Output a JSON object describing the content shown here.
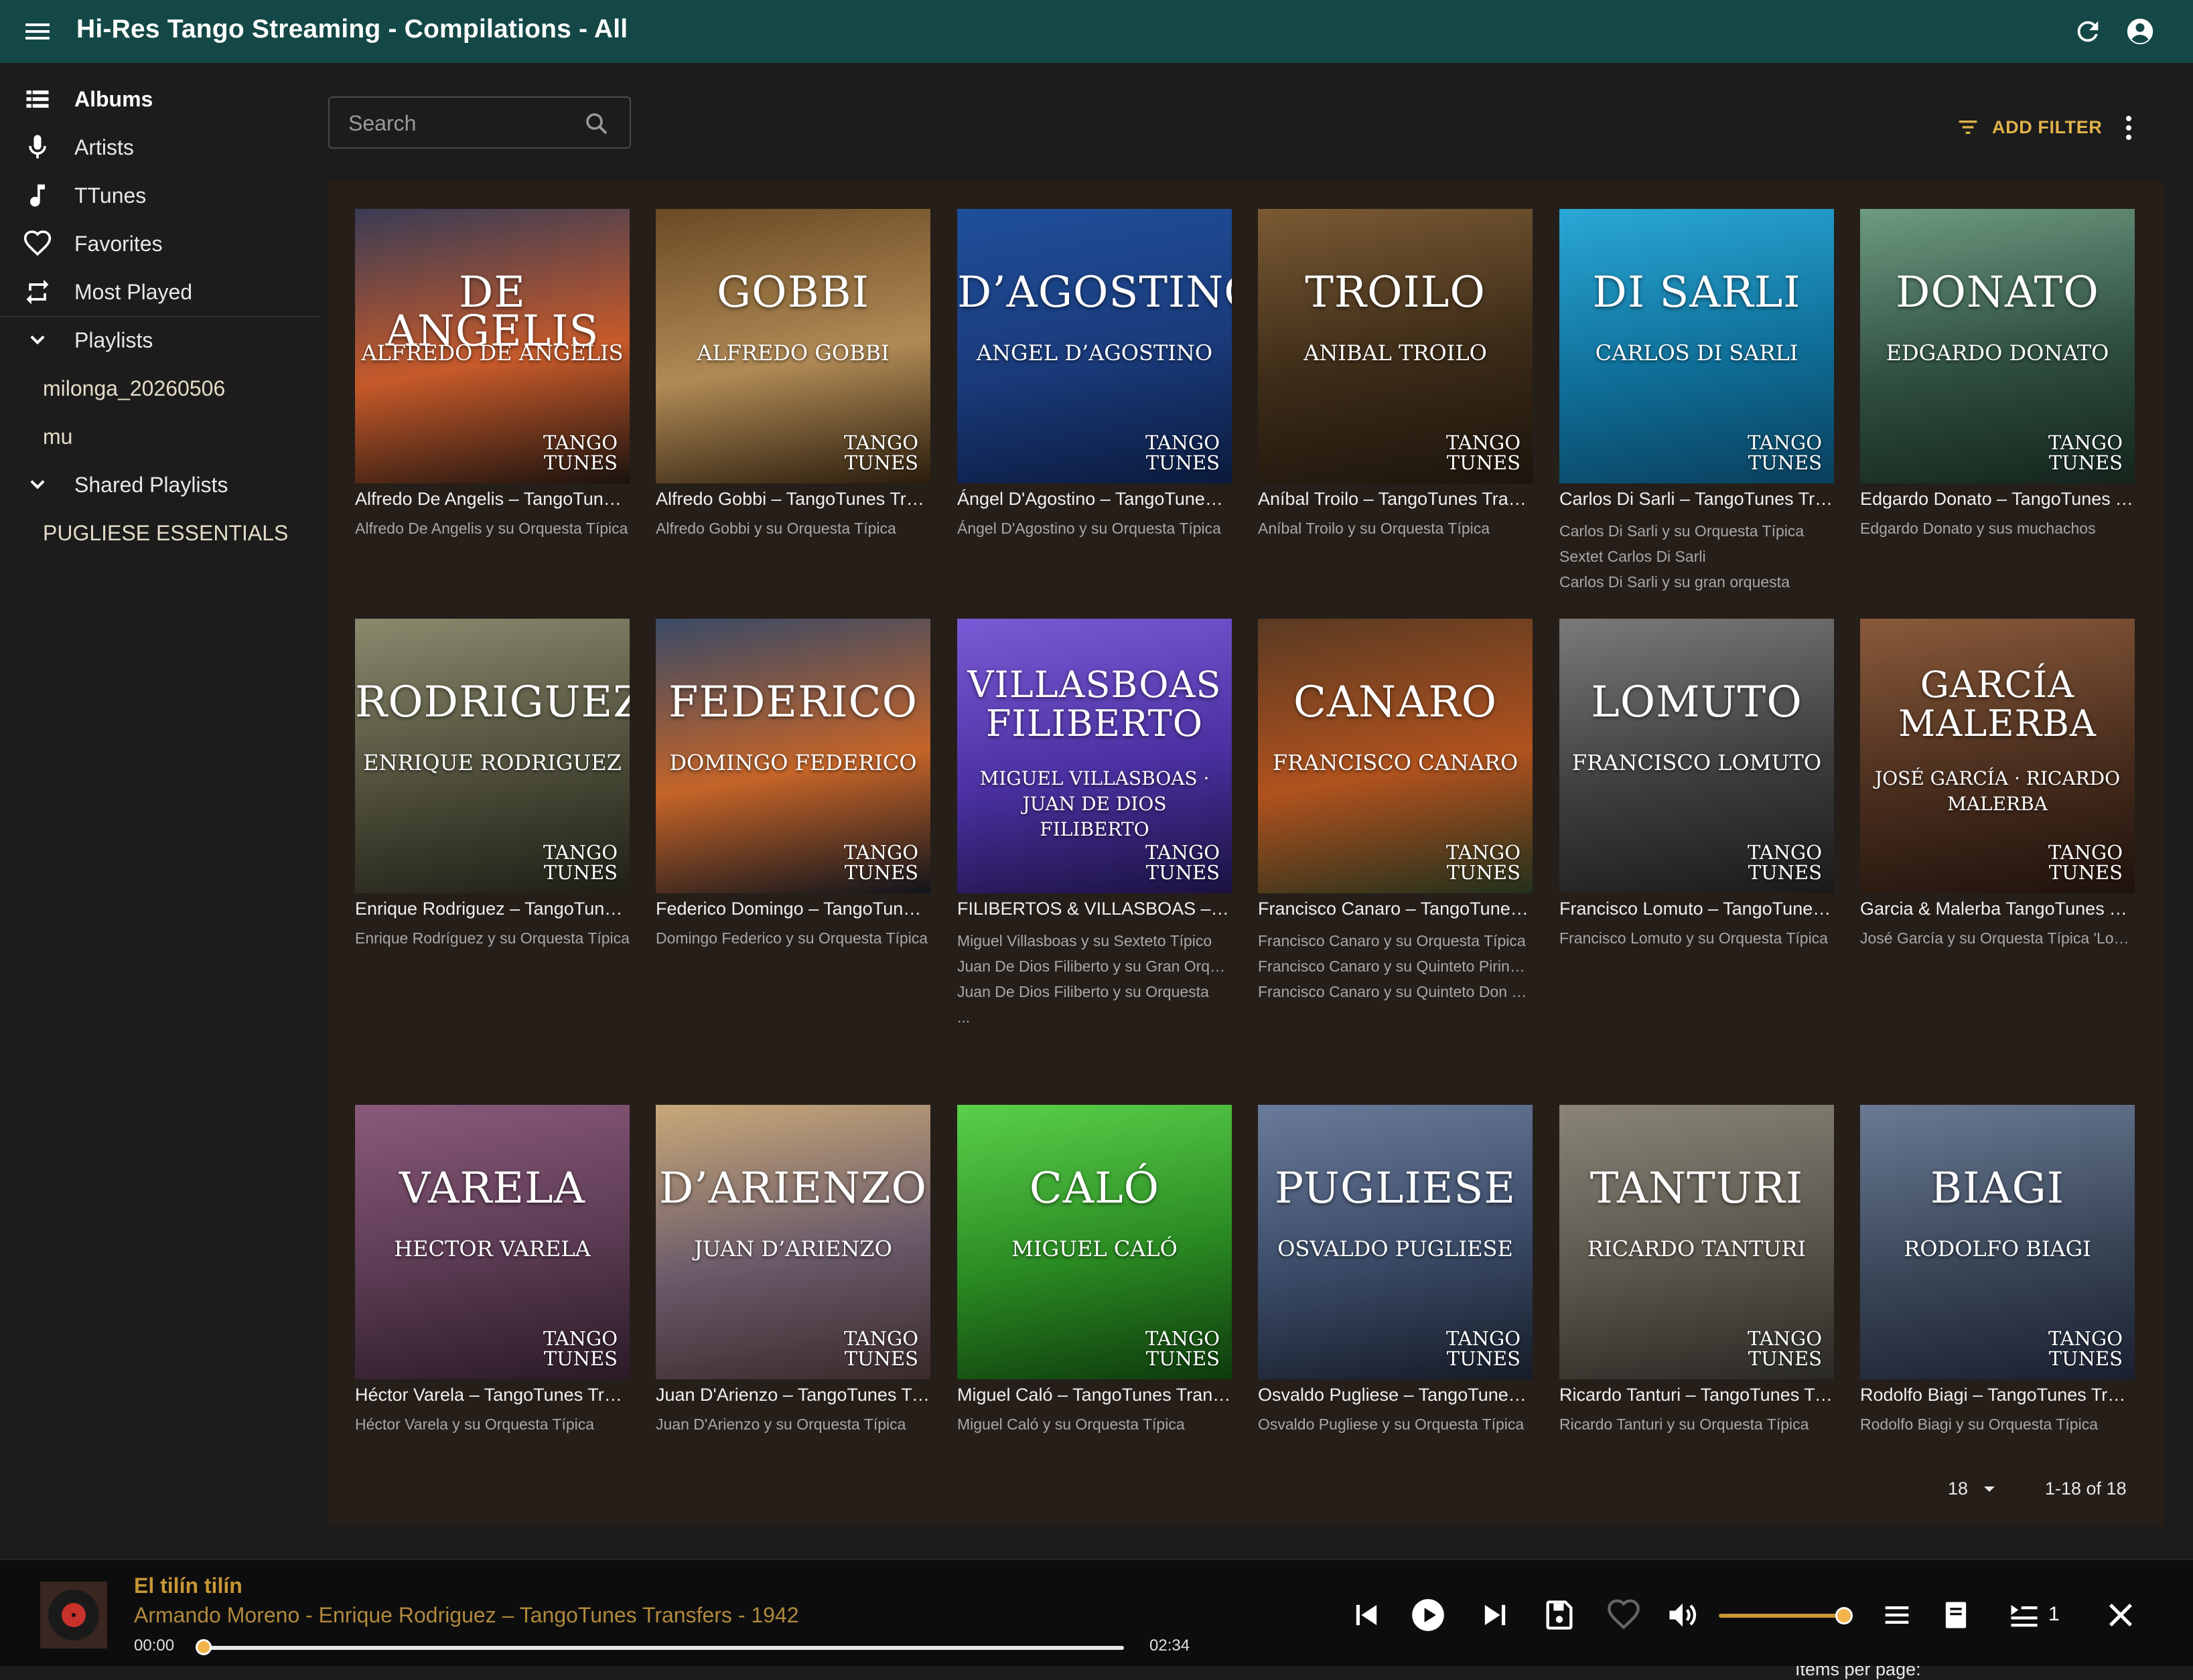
{
  "app": {
    "title": "Hi-Res Tango Streaming - Compilations - All"
  },
  "sidebar": {
    "items": [
      {
        "label": "Albums",
        "icon": "albums-icon"
      },
      {
        "label": "Artists",
        "icon": "microphone-icon"
      },
      {
        "label": "TTunes",
        "icon": "music-note-icon"
      },
      {
        "label": "Favorites",
        "icon": "heart-icon"
      },
      {
        "label": "Most Played",
        "icon": "repeat-icon"
      }
    ],
    "playlists_label": "Playlists",
    "playlists": [
      "milonga_20260506",
      "mu"
    ],
    "shared_label": "Shared Playlists",
    "shared": [
      "PUGLIESE ESSENTIALS"
    ]
  },
  "search": {
    "placeholder": "Search"
  },
  "toolbar": {
    "add_filter": "ADD FILTER"
  },
  "albums": [
    {
      "cover_title": "DE ANGELIS",
      "cover_sub": "ALFREDO DE ANGELIS",
      "title": "Alfredo De Angelis – TangoTunes Transfers",
      "artists": [
        "Alfredo De Angelis y su Orquesta Típica"
      ],
      "colors": [
        "#3a3c55",
        "#c65a2a",
        "#1a120e"
      ]
    },
    {
      "cover_title": "GOBBI",
      "cover_sub": "ALFREDO GOBBI",
      "title": "Alfredo Gobbi – TangoTunes Transfers",
      "artists": [
        "Alfredo Gobbi y su Orquesta Típica"
      ],
      "colors": [
        "#6b4a24",
        "#b08a55",
        "#2a1c0c"
      ]
    },
    {
      "cover_title": "D’AGOSTINO",
      "cover_sub": "ANGEL D’AGOSTINO",
      "title": "Ángel D'Agostino – TangoTunes Transfers",
      "artists": [
        "Ángel D'Agostino y su Orquesta Típica"
      ],
      "colors": [
        "#1f4f9a",
        "#1a3a7a",
        "#0b1a3c"
      ]
    },
    {
      "cover_title": "TROILO",
      "cover_sub": "ANIBAL TROILO",
      "title": "Aníbal Troilo – TangoTunes Transfers",
      "artists": [
        "Aníbal Troilo y su Orquesta Típica"
      ],
      "colors": [
        "#7a5a33",
        "#3c2b18",
        "#1c140c"
      ]
    },
    {
      "cover_title": "DI SARLI",
      "cover_sub": "CARLOS DI SARLI",
      "title": "Carlos Di Sarli – TangoTunes Transfers",
      "artists": [
        "Carlos Di Sarli y su Orquesta Típica",
        "Sextet Carlos Di Sarli",
        "Carlos Di Sarli y su gran orquesta"
      ],
      "colors": [
        "#2aa8d6",
        "#0f6f99",
        "#0a3f5c"
      ]
    },
    {
      "cover_title": "DONATO",
      "cover_sub": "EDGARDO DONATO",
      "title": "Edgardo Donato – TangoTunes Transfers",
      "artists": [
        "Edgardo Donato y sus muchachos"
      ],
      "colors": [
        "#6e9a82",
        "#2f4f40",
        "#14241c"
      ]
    },
    {
      "cover_title": "RODRIGUEZ",
      "cover_sub": "ENRIQUE RODRIGUEZ",
      "title": "Enrique Rodriguez – TangoTunes Transfers",
      "artists": [
        "Enrique Rodríguez y su Orquesta Típica"
      ],
      "colors": [
        "#8a8a6e",
        "#4e4e3a",
        "#1e1e16"
      ]
    },
    {
      "cover_title": "FEDERICO",
      "cover_sub": "DOMINGO FEDERICO",
      "title": "Federico Domingo – TangoTunes Transfers",
      "artists": [
        "Domingo Federico y su Orquesta Típica"
      ],
      "colors": [
        "#3a4a66",
        "#c46428",
        "#10141c"
      ]
    },
    {
      "cover_title": "VILLASBOAS FILIBERTO",
      "cover_sub": "MIGUEL VILLASBOAS · JUAN DE DIOS FILIBERTO",
      "title": "FILIBERTOS & VILLASBOAS – TangoTunes Transfers",
      "artists": [
        "Miguel Villasboas y su Sexteto Típico",
        "Juan De Dios Filiberto y su Gran Orquesta",
        "Juan De Dios Filiberto y su Orquesta",
        "..."
      ],
      "colors": [
        "#7a5ad6",
        "#4a30a0",
        "#1a1240"
      ]
    },
    {
      "cover_title": "CANARO",
      "cover_sub": "FRANCISCO CANARO",
      "title": "Francisco Canaro – TangoTunes Transfers",
      "artists": [
        "Francisco Canaro y su Orquesta Típica",
        "Francisco Canaro y su Quinteto Pirincho",
        "Francisco Canaro y su Quinteto Don Pancho"
      ],
      "colors": [
        "#5a3a22",
        "#b0521e",
        "#22301c"
      ]
    },
    {
      "cover_title": "LOMUTO",
      "cover_sub": "FRANCISCO LOMUTO",
      "title": "Francisco Lomuto – TangoTunes Transfers",
      "artists": [
        "Francisco Lomuto y su Orquesta Típica"
      ],
      "colors": [
        "#7a7a7a",
        "#3e3e3e",
        "#1a1a1a"
      ]
    },
    {
      "cover_title": "GARCÍA MALERBA",
      "cover_sub": "JOSÉ GARCÍA · RICARDO MALERBA",
      "title": "Garcia & Malerba TangoTunes Transfers",
      "artists": [
        "José García y su Orquesta Típica 'Los Zorros Grises'"
      ],
      "colors": [
        "#8a5a3a",
        "#4a2e1e",
        "#1e120c"
      ]
    },
    {
      "cover_title": "VARELA",
      "cover_sub": "HECTOR VARELA",
      "title": "Héctor Varela – TangoTunes Transfers",
      "artists": [
        "Héctor Varela y su Orquesta Típica"
      ],
      "colors": [
        "#8a5a7a",
        "#5a3a52",
        "#2a1a26"
      ]
    },
    {
      "cover_title": "D’ARIENZO",
      "cover_sub": "JUAN D’ARIENZO",
      "title": "Juan D'Arienzo – TangoTunes Transfers",
      "artists": [
        "Juan D'Arienzo y su Orquesta Típica"
      ],
      "colors": [
        "#c8a878",
        "#6a5a6a",
        "#3a2a2a"
      ]
    },
    {
      "cover_title": "CALÓ",
      "cover_sub": "MIGUEL CALÓ",
      "title": "Miguel Caló – TangoTunes Transfers",
      "artists": [
        "Miguel Caló y su Orquesta Típica"
      ],
      "colors": [
        "#5ad04a",
        "#2a8a22",
        "#0e3a0c"
      ]
    },
    {
      "cover_title": "PUGLIESE",
      "cover_sub": "OSVALDO PUGLIESE",
      "title": "Osvaldo Pugliese – TangoTunes Transfers",
      "artists": [
        "Osvaldo Pugliese y su Orquesta Típica"
      ],
      "colors": [
        "#6a7a9a",
        "#3a4a66",
        "#161c28"
      ]
    },
    {
      "cover_title": "TANTURI",
      "cover_sub": "RICARDO TANTURI",
      "title": "Ricardo Tanturi – TangoTunes Transfers",
      "artists": [
        "Ricardo Tanturi y su Orquesta Típica"
      ],
      "colors": [
        "#8a8478",
        "#5a564c",
        "#2a2824"
      ]
    },
    {
      "cover_title": "BIAGI",
      "cover_sub": "RODOLFO BIAGI",
      "title": "Rodolfo Biagi – TangoTunes Transfers",
      "artists": [
        "Rodolfo Biagi y su Orquesta Típica"
      ],
      "colors": [
        "#6a7a94",
        "#3a4658",
        "#1a2030"
      ]
    }
  ],
  "brand": {
    "line1": "TANGO",
    "line2": "TUNES"
  },
  "pagination": {
    "items_per_page_label": "Items per page:",
    "items_per_page": "18",
    "range": "1-18 of 18"
  },
  "player": {
    "title": "El tilín tilín",
    "subtitle": "Armando Moreno - Enrique Rodriguez – TangoTunes Transfers - 1942",
    "elapsed": "00:00",
    "duration": "02:34",
    "progress": 0.0,
    "volume": 0.93,
    "queue_count": "1"
  },
  "colors": {
    "appbar": "#134846",
    "accent": "#e0b24a",
    "panel": "#251e19"
  }
}
